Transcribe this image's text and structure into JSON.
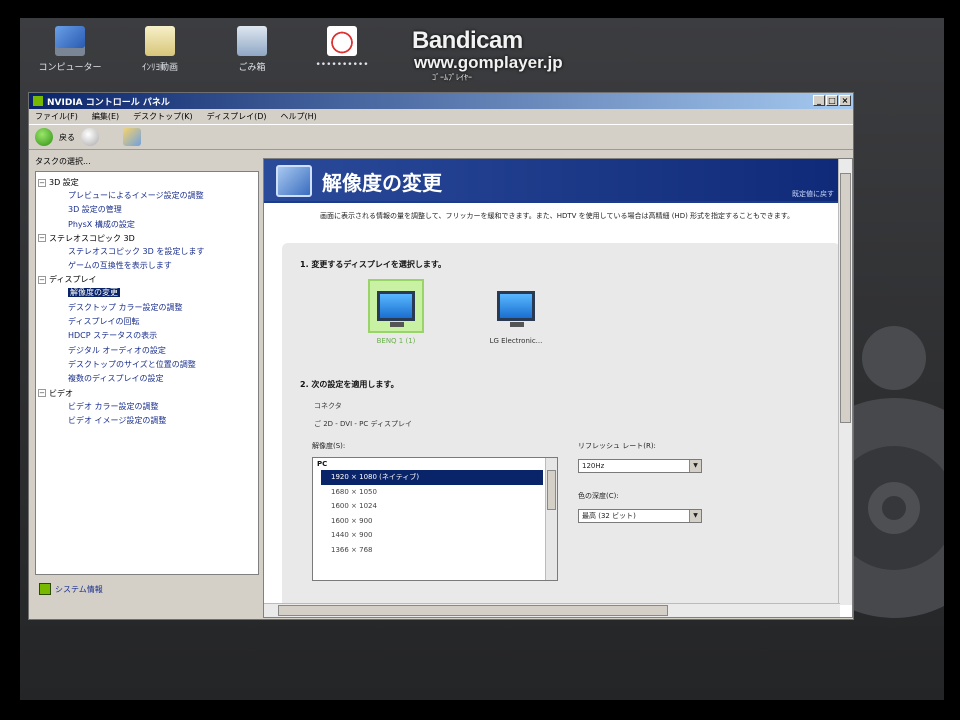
{
  "desktop": {
    "icons": [
      {
        "label": "コンピューター",
        "icon": "computer-icon"
      },
      {
        "label": "ｲﾝﾘﾖ動画",
        "icon": "folder-icon"
      },
      {
        "label": "ごみ箱",
        "icon": "recycle-bin-icon"
      },
      {
        "label": "••••••••••",
        "icon": "app-icon"
      }
    ]
  },
  "watermark": {
    "brand": "Bandicam",
    "url": "www.gomplayer.jp",
    "sub": "ｺﾞｰﾑﾌﾟﾚｲﾔｰ"
  },
  "window": {
    "title": "NVIDIA コントロール パネル",
    "menu": [
      "ファイル(F)",
      "編集(E)",
      "デスクトップ(K)",
      "ディスプレイ(D)",
      "ヘルプ(H)"
    ],
    "toolbar": {
      "back_label": "戻る"
    }
  },
  "left_pane": {
    "task_label": "タスクの選択...",
    "groups": [
      {
        "label": "3D 設定",
        "items": [
          "プレビューによるイメージ設定の調整",
          "3D 設定の管理",
          "PhysX 構成の設定"
        ]
      },
      {
        "label": "ステレオスコピック 3D",
        "items": [
          "ステレオスコピック 3D を設定します",
          "ゲームの互換性を表示します"
        ]
      },
      {
        "label": "ディスプレイ",
        "items": [
          "解像度の変更",
          "デスクトップ カラー設定の調整",
          "ディスプレイの回転",
          "HDCP ステータスの表示",
          "デジタル オーディオの設定",
          "デスクトップのサイズと位置の調整",
          "複数のディスプレイの設定"
        ]
      },
      {
        "label": "ビデオ",
        "items": [
          "ビデオ カラー設定の調整",
          "ビデオ イメージ設定の調整"
        ]
      }
    ],
    "selected_item": "解像度の変更",
    "system_info": "システム情報"
  },
  "content": {
    "title": "解像度の変更",
    "restore_link": "既定値に戻す",
    "description": "画面に表示される情報の量を調整して、フリッカーを緩和できます。また、HDTV を使用している場合は高精細 (HD) 形式を指定することもできます。",
    "step1": "1. 変更するディスプレイを選択します。",
    "displays": [
      {
        "label": "BENQ 1 (1)",
        "selected": true
      },
      {
        "label": "LG Electronic...",
        "selected": false
      }
    ],
    "step2": "2. 次の設定を適用します。",
    "connection_label": "コネクタ",
    "connection_value": "ご 2D - DVI - PC ディスプレイ",
    "resolution_label": "解像度(S):",
    "resolution_group": "PC",
    "resolutions": [
      "1920 × 1080 (ネイティブ)",
      "1680 × 1050",
      "1600 × 1024",
      "1600 × 900",
      "1440 × 900",
      "1366 × 768"
    ],
    "selected_resolution": "1920 × 1080 (ネイティブ)",
    "refresh_label": "リフレッシュ レート(R):",
    "refresh_value": "120Hz",
    "color_depth_label": "色の深度(C):",
    "color_depth_value": "最高 (32 ビット)"
  }
}
